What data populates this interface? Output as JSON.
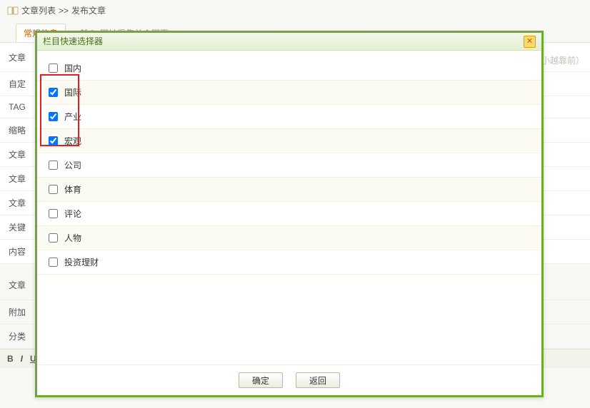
{
  "crumb": {
    "main": "文章列表",
    "sep": ">>",
    "sub": "发布文章"
  },
  "tab": {
    "label": "常规信息",
    "hint": "▸ 输入 网址采集单个网页 ▸"
  },
  "form": {
    "rows": [
      "文章",
      "自定",
      "TAG",
      "缩略",
      "文章",
      "文章",
      "文章",
      "关键",
      "内容"
    ],
    "title_placeholder": "",
    "sort_hint": "(越小越靠前）"
  },
  "section2": {
    "heading": "文章"
  },
  "attach": {
    "label": "附加"
  },
  "cat": {
    "label": "分类"
  },
  "modal": {
    "title": "栏目快速选择器",
    "categories": [
      {
        "name": "国内",
        "checked": false
      },
      {
        "name": "国际",
        "checked": true
      },
      {
        "name": "产业",
        "checked": true
      },
      {
        "name": "宏观",
        "checked": true
      },
      {
        "name": "公司",
        "checked": false
      },
      {
        "name": "体育",
        "checked": false
      },
      {
        "name": "评论",
        "checked": false
      },
      {
        "name": "人物",
        "checked": false
      },
      {
        "name": "投资理财",
        "checked": false
      }
    ],
    "ok": "确定",
    "back": "返回"
  },
  "toolbar": {
    "items": [
      "B",
      "I",
      "U"
    ]
  }
}
